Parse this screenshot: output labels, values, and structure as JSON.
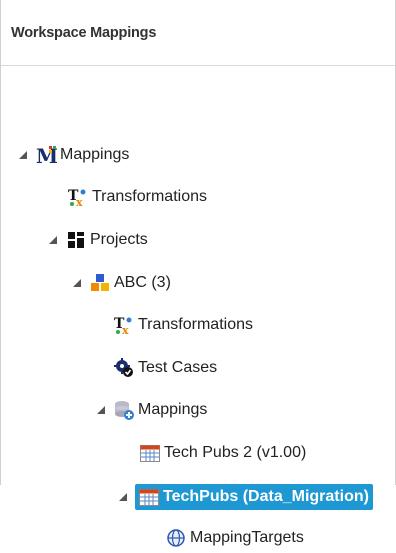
{
  "panel": {
    "title": "Workspace Mappings"
  },
  "tree": {
    "root": {
      "label": "Mappings"
    },
    "transformations_top": {
      "label": "Transformations"
    },
    "projects": {
      "label": "Projects"
    },
    "abc": {
      "label": "ABC (3)"
    },
    "abc_transformations": {
      "label": "Transformations"
    },
    "test_cases": {
      "label": "Test Cases"
    },
    "abc_mappings": {
      "label": "Mappings"
    },
    "techpubs2": {
      "label": "Tech Pubs 2 (v1.00)"
    },
    "techpubs_data": {
      "label": "TechPubs (Data_Migration)"
    },
    "mapping_targets": {
      "label": "MappingTargets"
    }
  },
  "colors": {
    "selection": "#1d98d3",
    "mapping_m": "#1a2d6b"
  },
  "icons": {
    "toggle": "triangle-expanded-icon",
    "root": "mappings-m-icon",
    "transformations": "transformations-tx-icon",
    "projects": "projects-grid-icon",
    "abc": "project-blocks-icon",
    "test_cases": "gear-check-icon",
    "mappings": "database-mapping-icon",
    "table": "table-calendar-icon",
    "targets": "globe-target-icon"
  }
}
